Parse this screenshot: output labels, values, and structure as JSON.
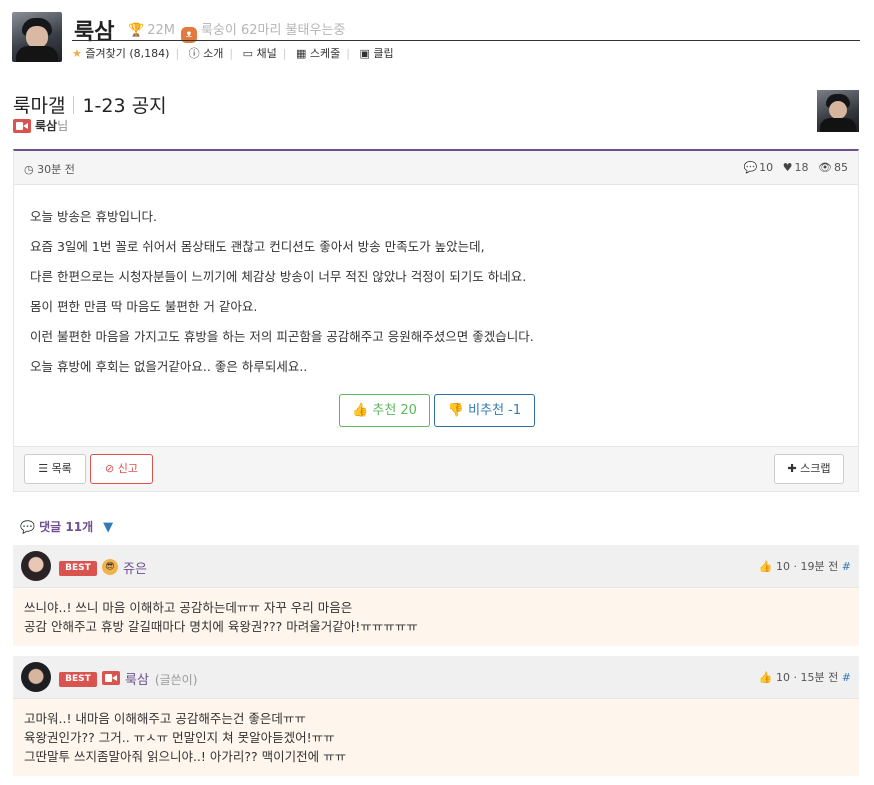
{
  "channel": {
    "name": "룩삼",
    "fans": "22M",
    "status": "룩숭이 62마리 불태우는중",
    "links": [
      {
        "label": "즐겨찾기 (8,184)",
        "icon": "star-icon"
      },
      {
        "label": "소개",
        "icon": "info-icon"
      },
      {
        "label": "채널",
        "icon": "twitch-icon"
      },
      {
        "label": "스케줄",
        "icon": "calendar-icon"
      },
      {
        "label": "클립",
        "icon": "film-icon"
      }
    ]
  },
  "post": {
    "category": "룩마갤",
    "title": "1-23 공지",
    "author": "룩삼",
    "author_suffix": "님",
    "time": "30분 전",
    "comments": "10",
    "likes": "18",
    "views": "85",
    "body": [
      "오늘 방송은 휴방입니다.",
      "요즘 3일에 1번 꼴로 쉬어서 몸상태도 괜찮고 컨디션도 좋아서 방송 만족도가 높았는데,",
      "다른 한편으로는 시청자분들이 느끼기에 체감상 방송이 너무 적진 않았나 걱정이 되기도 하네요.",
      "몸이 편한 만큼 딱 마음도 불편한 거 같아요.",
      "이런 불편한 마음을 가지고도 휴방을 하는 저의 피곤함을 공감해주고 응원해주셨으면 좋겠습니다.",
      "오늘 휴방에 후회는 없을거같아요.. 좋은 하루되세요.."
    ],
    "upvote_label": "추천 20",
    "downvote_label": "비추천 -1"
  },
  "actions": {
    "list_label": "목록",
    "report_label": "신고",
    "scrap_label": "스크랩"
  },
  "comments_section": {
    "title": "댓글 11개",
    "toggle": "▼"
  },
  "comments": [
    {
      "badge": "BEST",
      "name": "쥬은",
      "writer_tag": "",
      "likes": "10",
      "time": "19분 전",
      "hash": "#",
      "lines": [
        "쓰니야..! 쓰니 마음 이해하고 공감하는데ㅠㅠ 자꾸 우리 마음은",
        "공감 안해주고 휴방 갈길때마다 명치에 육왕권??? 마려울거같아!ㅠㅠㅠㅠㅠ"
      ]
    },
    {
      "badge": "BEST",
      "name": "룩삼",
      "writer_tag": "(글쓴이)",
      "likes": "10",
      "time": "15분 전",
      "hash": "#",
      "lines": [
        "고마워..! 내마음 이해해주고 공감해주는건 좋은데ㅠㅠ",
        "육왕권인가?? 그거.. ㅠㅅㅠ 먼말인지 쳐 못알아듣겠어!ㅠㅠ",
        "그딴말투 쓰지좀말아줘 읽으니야..! 아가리?? 맥이기전에 ㅠㅠ"
      ]
    }
  ],
  "colors": {
    "accent": "#6e4f8f",
    "best": "#d9534f",
    "upvote": "#5cb85c",
    "downvote": "#337ab7",
    "comment_bg": "#fef5ec"
  }
}
